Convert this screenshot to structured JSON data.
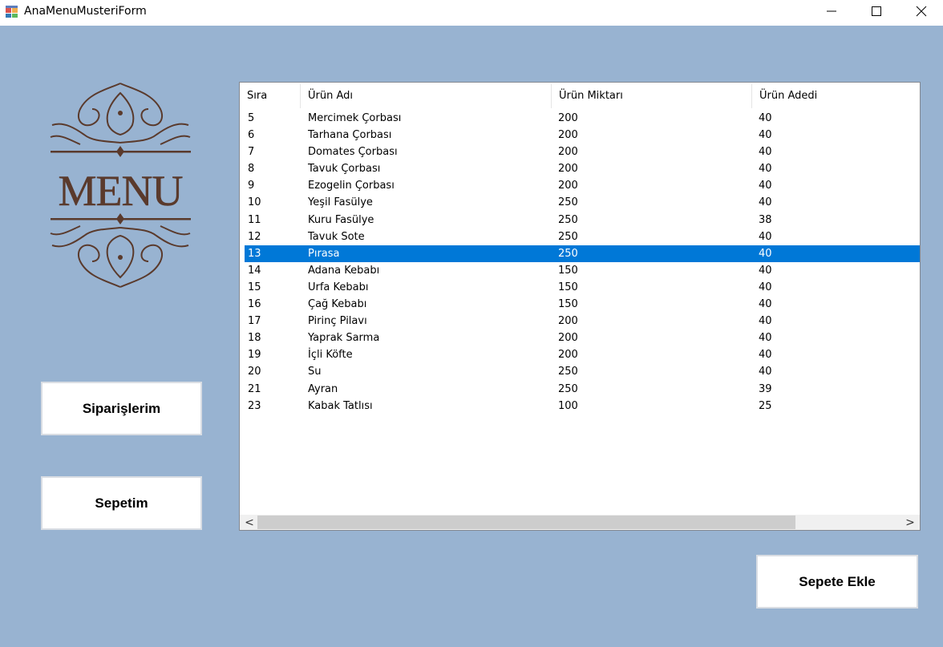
{
  "window": {
    "title": "AnaMenuMusteriForm"
  },
  "logo": {
    "text": "MENU"
  },
  "buttons": {
    "siparislerim": "Siparişlerim",
    "sepetim": "Sepetim",
    "sepete_ekle": "Sepete Ekle"
  },
  "grid": {
    "columns": [
      "Sıra",
      "Ürün Adı",
      "Ürün Miktarı",
      "Ürün Adedi"
    ],
    "selected_index": 8,
    "rows": [
      [
        "5",
        "Mercimek Çorbası",
        "200",
        "40"
      ],
      [
        "6",
        "Tarhana Çorbası",
        "200",
        "40"
      ],
      [
        "7",
        "Domates Çorbası",
        "200",
        "40"
      ],
      [
        "8",
        "Tavuk Çorbası",
        "200",
        "40"
      ],
      [
        "9",
        "Ezogelin Çorbası",
        "200",
        "40"
      ],
      [
        "10",
        "Yeşil Fasülye",
        "250",
        "40"
      ],
      [
        "11",
        "Kuru Fasülye",
        "250",
        "38"
      ],
      [
        "12",
        "Tavuk Sote",
        "250",
        "40"
      ],
      [
        "13",
        "Pırasa",
        "250",
        "40"
      ],
      [
        "14",
        "Adana Kebabı",
        "150",
        "40"
      ],
      [
        "15",
        "Urfa Kebabı",
        "150",
        "40"
      ],
      [
        "16",
        "Çağ Kebabı",
        "150",
        "40"
      ],
      [
        "17",
        "Pirinç Pilavı",
        "200",
        "40"
      ],
      [
        "18",
        "Yaprak Sarma",
        "200",
        "40"
      ],
      [
        "19",
        "İçli Köfte",
        "200",
        "40"
      ],
      [
        "20",
        "Su",
        "250",
        "40"
      ],
      [
        "21",
        "Ayran",
        "250",
        "39"
      ],
      [
        "23",
        "Kabak Tatlısı",
        "100",
        "25"
      ]
    ]
  },
  "scrollbar": {
    "left_arrow": "<",
    "right_arrow": ">"
  }
}
